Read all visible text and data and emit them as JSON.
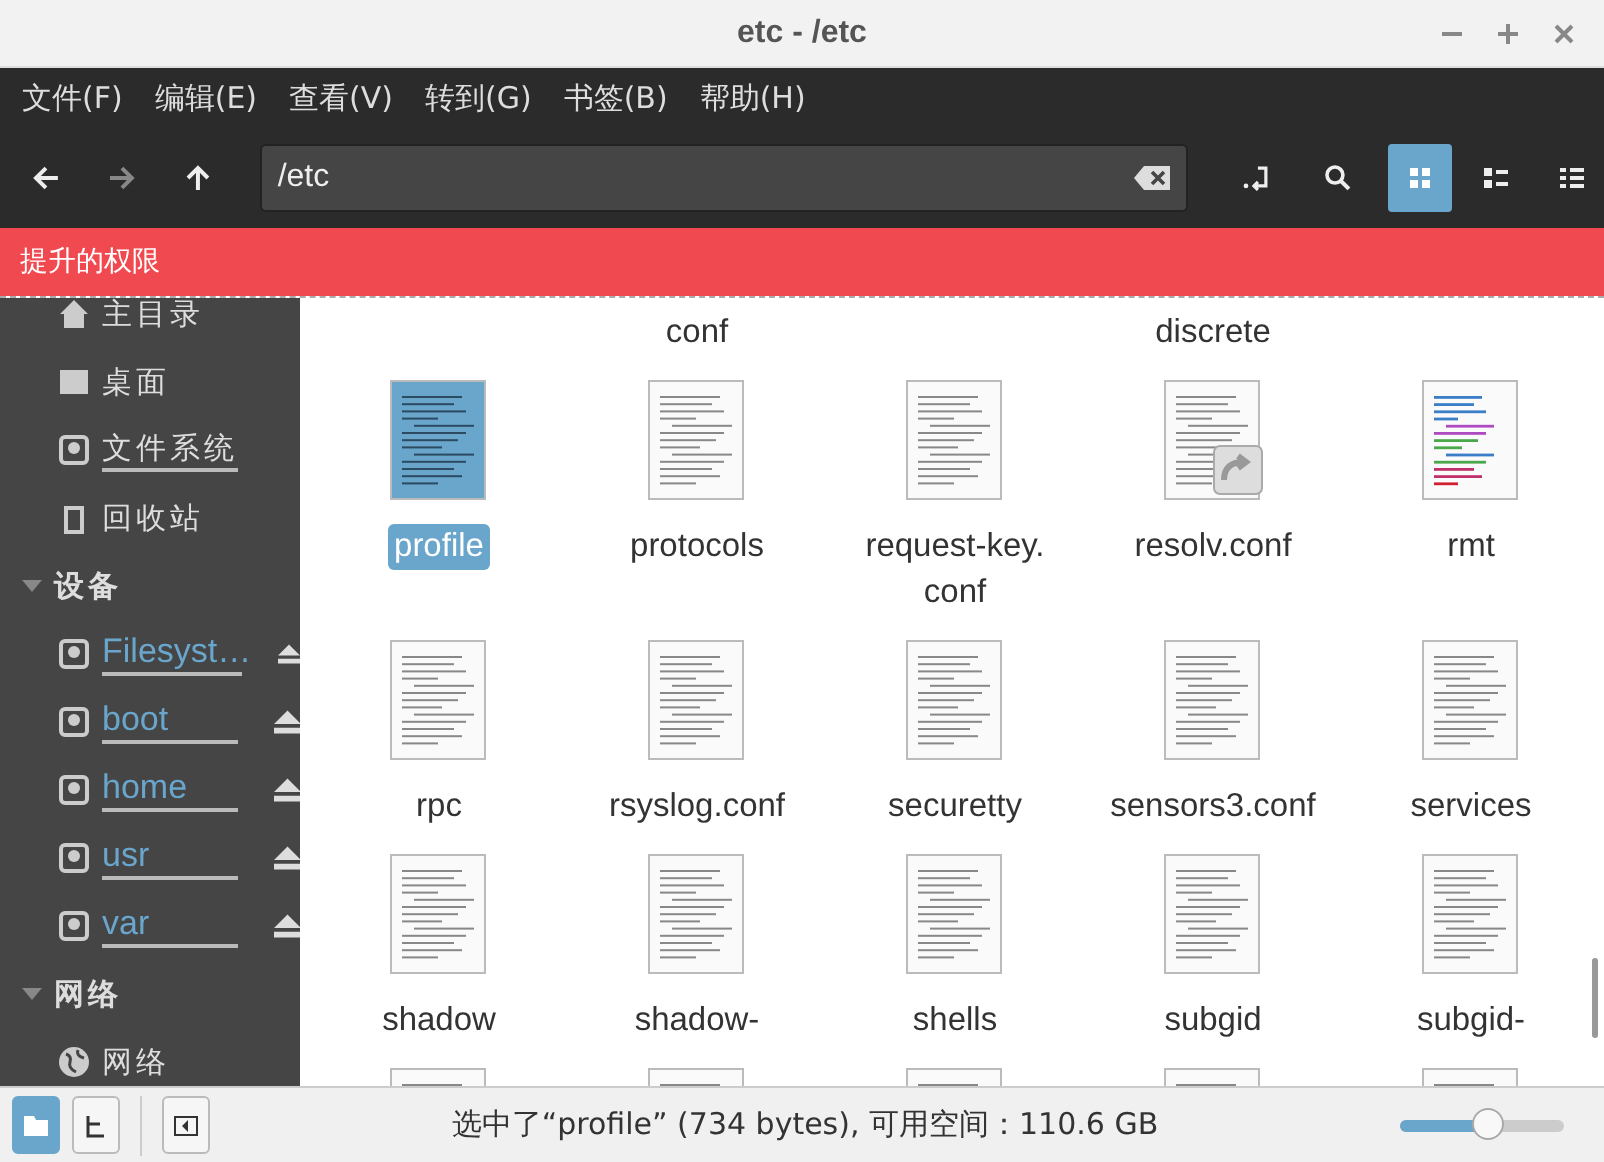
{
  "window": {
    "title": "etc - /etc"
  },
  "menu": [
    "文件(F)",
    "编辑(E)",
    "查看(V)",
    "转到(G)",
    "书签(B)",
    "帮助(H)"
  ],
  "toolbar": {
    "back_disabled": false,
    "forward_disabled": true,
    "location": "/etc",
    "views": [
      {
        "kind": "icons",
        "selected": true
      },
      {
        "kind": "compact",
        "selected": false
      },
      {
        "kind": "list",
        "selected": false
      }
    ]
  },
  "banner": "提升的权限",
  "sidebar": {
    "places": [
      {
        "label": "主目录",
        "kind": "home",
        "bar": false
      },
      {
        "label": "桌面",
        "kind": "desktop",
        "bar": false
      },
      {
        "label": "文件系统",
        "kind": "drive",
        "bar": true
      },
      {
        "label": "回收站",
        "kind": "trash",
        "bar": false
      }
    ],
    "sections": [
      {
        "title": "设备",
        "expanded": true,
        "items": [
          {
            "label": "Filesyst…",
            "kind": "drive",
            "bar": true,
            "eject": true
          },
          {
            "label": "boot",
            "kind": "drive",
            "bar": true,
            "eject": true
          },
          {
            "label": "home",
            "kind": "drive",
            "bar": true,
            "eject": true
          },
          {
            "label": "usr",
            "kind": "drive",
            "bar": true,
            "eject": true
          },
          {
            "label": "var",
            "kind": "drive",
            "bar": true,
            "eject": true
          }
        ]
      },
      {
        "title": "网络",
        "expanded": true,
        "items": [
          {
            "label": "网络",
            "kind": "globe",
            "bar": false,
            "eject": false
          }
        ]
      }
    ]
  },
  "files": [
    {
      "kind": "cut-top"
    },
    {
      "kind": "cut-top",
      "name": "conf"
    },
    {
      "kind": "cut-top"
    },
    {
      "kind": "cut-top",
      "name": "discrete"
    },
    {
      "kind": "cut-top"
    },
    {
      "name": "profile",
      "kind": "text",
      "selected": true
    },
    {
      "name": "protocols",
      "kind": "text",
      "selected": false
    },
    {
      "name": "request-key.\nconf",
      "kind": "text",
      "selected": false
    },
    {
      "name": "resolv.conf",
      "kind": "symlink",
      "selected": false
    },
    {
      "name": "rmt",
      "kind": "code",
      "selected": false
    },
    {
      "name": "rpc",
      "kind": "text",
      "selected": false
    },
    {
      "name": "rsyslog.conf",
      "kind": "text",
      "selected": false
    },
    {
      "name": "securetty",
      "kind": "text",
      "selected": false
    },
    {
      "name": "sensors3.conf",
      "kind": "text",
      "selected": false
    },
    {
      "name": "services",
      "kind": "text",
      "selected": false
    },
    {
      "name": "shadow",
      "kind": "text",
      "selected": false
    },
    {
      "name": "shadow-",
      "kind": "text",
      "selected": false
    },
    {
      "name": "shells",
      "kind": "text",
      "selected": false
    },
    {
      "name": "subgid",
      "kind": "text",
      "selected": false
    },
    {
      "name": "subgid-",
      "kind": "text",
      "selected": false
    },
    {
      "kind": "cut-bottom"
    },
    {
      "kind": "cut-bottom"
    },
    {
      "kind": "cut-bottom"
    },
    {
      "kind": "cut-bottom"
    },
    {
      "kind": "cut-bottom"
    }
  ],
  "status_bar": {
    "panes": [
      {
        "kind": "places",
        "selected": true
      },
      {
        "kind": "tree",
        "selected": false
      }
    ],
    "text": "选中了“profile” (734 bytes), 可用空间：110.6 GB",
    "zoom": {
      "level": 0.55
    }
  }
}
